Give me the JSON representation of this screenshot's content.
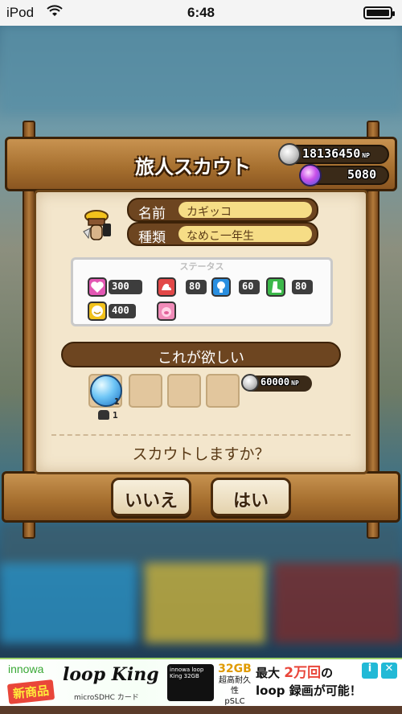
{
  "status_bar": {
    "carrier": "iPod",
    "wifi_icon": "◔",
    "time": "6:48"
  },
  "dialog": {
    "title": "旅人スカウト",
    "coins": "18136450",
    "coins_unit": "NP",
    "gems": "5080",
    "name_label": "名前",
    "name_value": "カギッコ",
    "type_label": "種類",
    "type_value": "なめこ一年生",
    "status_title": "ステータス",
    "stats": [
      {
        "icon": "heart-icon",
        "color": "#e257b3",
        "value": "300"
      },
      {
        "icon": "muscle-icon",
        "color": "#e24848",
        "value": "80"
      },
      {
        "icon": "bulb-icon",
        "color": "#2a8fe0",
        "value": "60"
      },
      {
        "icon": "boot-icon",
        "color": "#3cb84a",
        "value": "80"
      },
      {
        "icon": "smile-icon",
        "color": "#f2c21c",
        "value": "400"
      },
      {
        "icon": "pig-icon",
        "color": "#f08bb8",
        "value": ""
      }
    ],
    "want_label": "これが欲しい",
    "want_item_count": "1",
    "want_owned_count": "1",
    "price": "60000",
    "price_unit": "NP",
    "question": "スカウトしますか？",
    "no_button": "いいえ",
    "yes_button": "はい"
  },
  "ad": {
    "brand": "innowa",
    "badge": "新商品",
    "product": "loop King",
    "product_sub": "microSDHC カード",
    "card_text": "innowa loop King 32GB",
    "spec_size": "32GB",
    "spec_line1": "超高耐久性",
    "spec_line2": "pSLC",
    "headline_1a": "最大",
    "headline_1b": "2万回",
    "headline_1c": "の",
    "headline_2": "loop 録画が可能！",
    "info_label": "i",
    "close_label": "✕"
  }
}
